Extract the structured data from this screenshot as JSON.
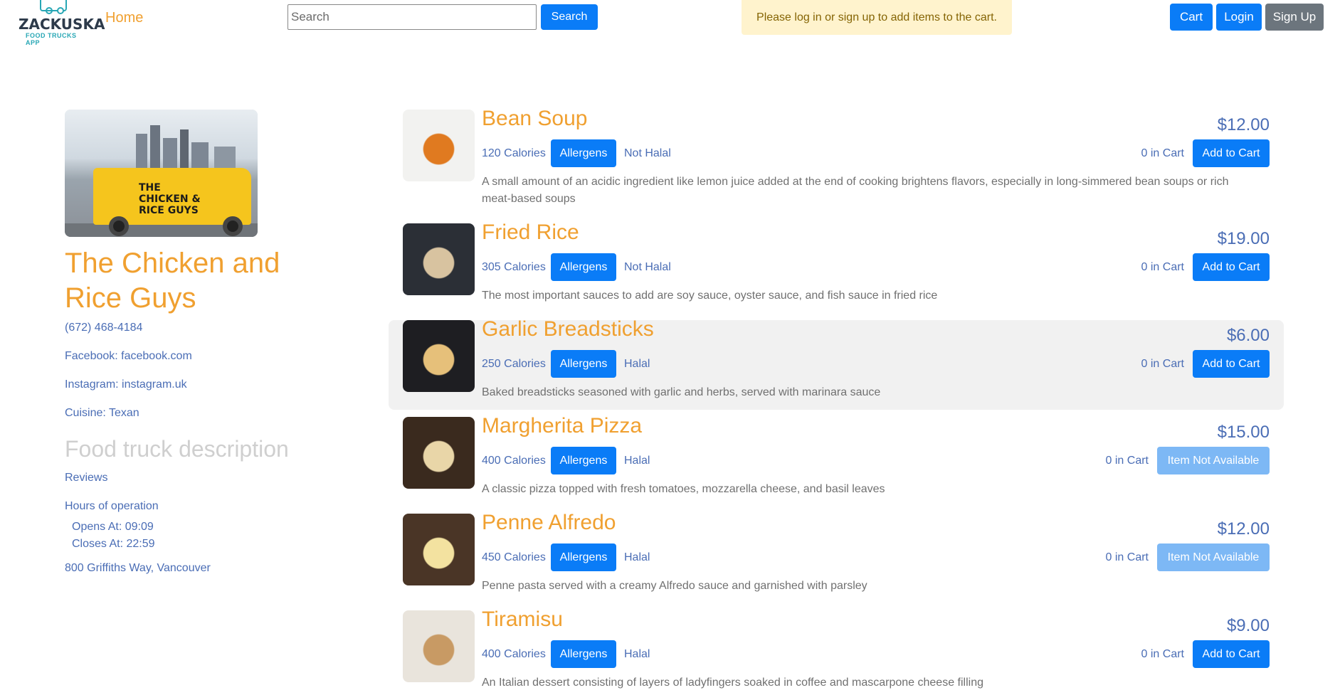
{
  "nav": {
    "logo_brand": "ZACKUSKA",
    "logo_tag": "FOOD TRUCKS APP",
    "home": "Home",
    "search_placeholder": "Search",
    "search_button": "Search",
    "alert": "Please log in or sign up to add items to the cart.",
    "cart": "Cart",
    "login": "Login",
    "signup": "Sign Up"
  },
  "truck": {
    "name": "The Chicken and Rice Guys",
    "van_text": "THE CHICKEN & RICE GUYS",
    "phone": "(672) 468-4184",
    "facebook": "Facebook: facebook.com",
    "instagram": "Instagram: instagram.uk",
    "cuisine": "Cuisine: Texan",
    "description_title": "Food truck description",
    "reviews": "Reviews",
    "hours_title": "Hours of operation",
    "opens": "Opens At: 09:09",
    "closes": "Closes At: 22:59",
    "address": "800 Griffiths Way, Vancouver"
  },
  "menu": [
    {
      "name": "Bean Soup",
      "calories": "120 Calories",
      "allergens": "Allergens",
      "halal": "Not Halal",
      "price": "$12.00",
      "in_cart": "0 in Cart",
      "action": "Add to Cart",
      "available": true,
      "desc": "A small amount of an acidic ingredient like lemon juice added at the end of cooking brightens flavors, especially in long-simmered bean soups or rich meat-based soups",
      "img_colors": [
        "#f2f2f0",
        "#e07a20"
      ]
    },
    {
      "name": "Fried Rice",
      "calories": "305 Calories",
      "allergens": "Allergens",
      "halal": "Not Halal",
      "price": "$19.00",
      "in_cart": "0 in Cart",
      "action": "Add to Cart",
      "available": true,
      "desc": "The most important sauces to add are soy sauce, oyster sauce, and fish sauce in fried rice",
      "img_colors": [
        "#2b2f36",
        "#d8c3a0"
      ]
    },
    {
      "name": "Garlic Breadsticks",
      "calories": "250 Calories",
      "allergens": "Allergens",
      "halal": "Halal",
      "price": "$6.00",
      "in_cart": "0 in Cart",
      "action": "Add to Cart",
      "available": true,
      "desc": "Baked breadsticks seasoned with garlic and herbs, served with marinara sauce",
      "img_colors": [
        "#1e1e22",
        "#e6c07a"
      ]
    },
    {
      "name": "Margherita Pizza",
      "calories": "400 Calories",
      "allergens": "Allergens",
      "halal": "Halal",
      "price": "$15.00",
      "in_cart": "0 in Cart",
      "action": "Item Not Available",
      "available": false,
      "desc": "A classic pizza topped with fresh tomatoes, mozzarella cheese, and basil leaves",
      "img_colors": [
        "#3a2a1e",
        "#e9d6a8"
      ]
    },
    {
      "name": "Penne Alfredo",
      "calories": "450 Calories",
      "allergens": "Allergens",
      "halal": "Halal",
      "price": "$12.00",
      "in_cart": "0 in Cart",
      "action": "Item Not Available",
      "available": false,
      "desc": "Penne pasta served with a creamy Alfredo sauce and garnished with parsley",
      "img_colors": [
        "#4a3526",
        "#f3e2a0"
      ]
    },
    {
      "name": "Tiramisu",
      "calories": "400 Calories",
      "allergens": "Allergens",
      "halal": "Halal",
      "price": "$9.00",
      "in_cart": "0 in Cart",
      "action": "Add to Cart",
      "available": true,
      "desc": "An Italian dessert consisting of layers of ladyfingers soaked in coffee and mascarpone cheese filling",
      "img_colors": [
        "#e9e4dc",
        "#c89a64"
      ]
    }
  ]
}
